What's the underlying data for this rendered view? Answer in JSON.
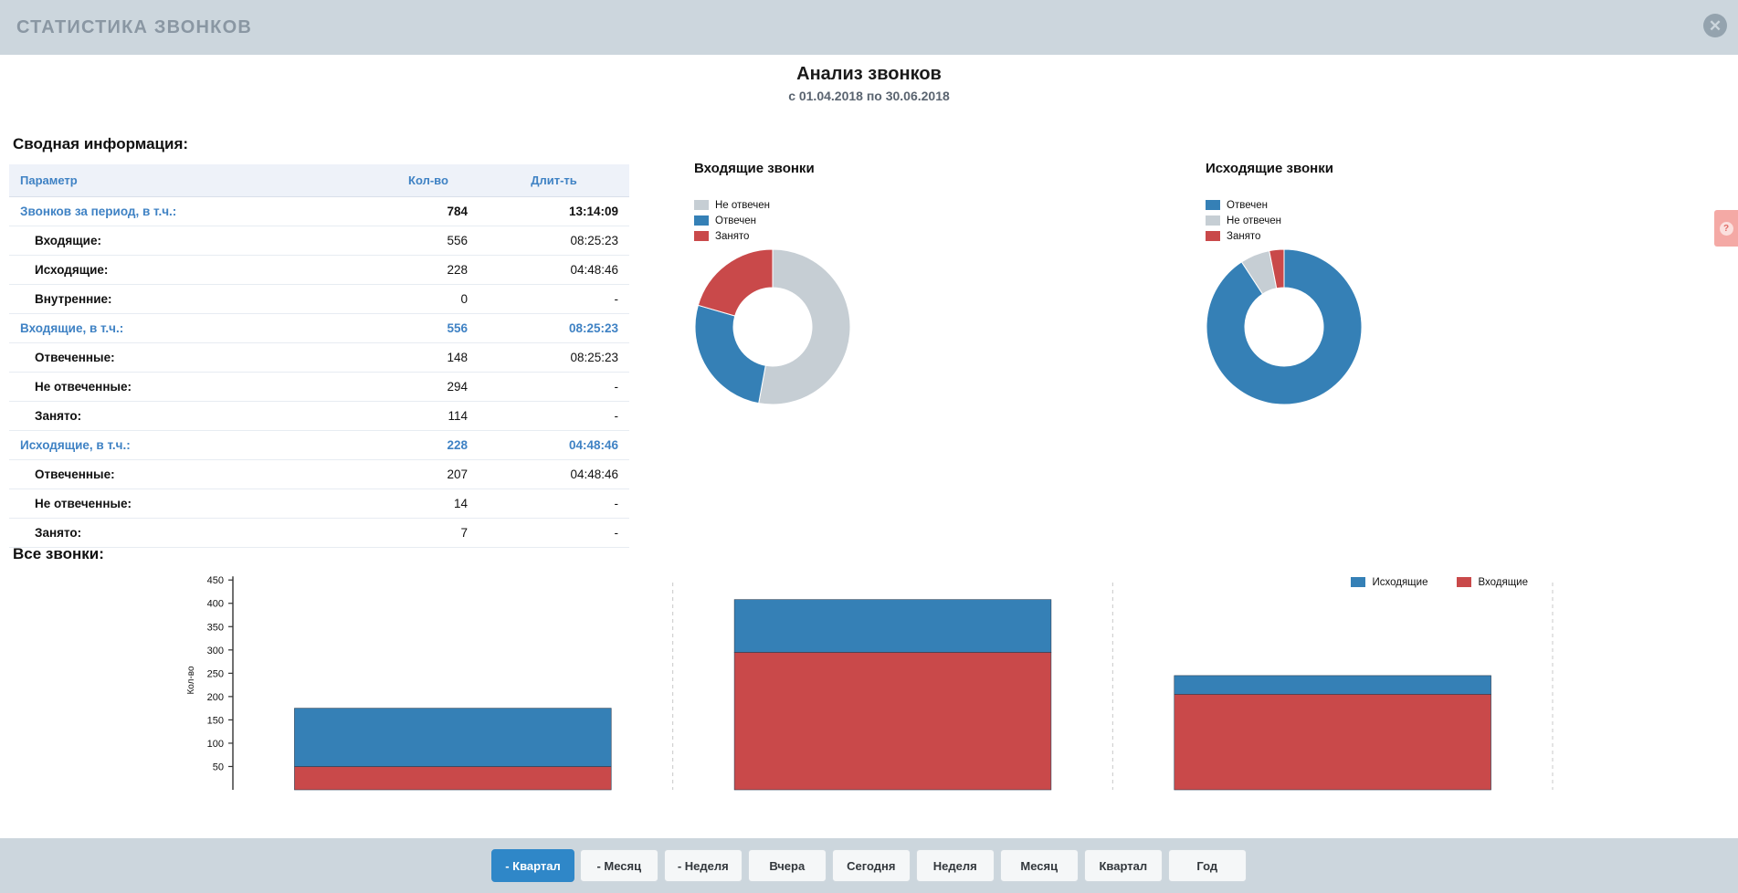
{
  "window": {
    "title": "СТАТИСТИКА ЗВОНКОВ",
    "close_icon": "close-circle-icon"
  },
  "report": {
    "title": "Анализ звонков",
    "subtitle": "с 01.04.2018 по 30.06.2018"
  },
  "sections": {
    "summary_label": "Сводная информация:",
    "all_calls_label": "Все звонки:"
  },
  "summary_table": {
    "columns": [
      "Параметр",
      "Кол-во",
      "Длит-ть"
    ],
    "rows": [
      {
        "level": 0,
        "total": true,
        "param": "Звонков за период, в т.ч.:",
        "count": "784",
        "duration": "13:14:09"
      },
      {
        "level": 1,
        "total": false,
        "param": "Входящие:",
        "count": "556",
        "duration": "08:25:23"
      },
      {
        "level": 1,
        "total": false,
        "param": "Исходящие:",
        "count": "228",
        "duration": "04:48:46"
      },
      {
        "level": 1,
        "total": false,
        "param": "Внутренние:",
        "count": "0",
        "duration": "-"
      },
      {
        "level": 0,
        "total": false,
        "param": "Входящие, в т.ч.:",
        "count": "556",
        "duration": "08:25:23"
      },
      {
        "level": 1,
        "total": false,
        "param": "Отвеченные:",
        "count": "148",
        "duration": "08:25:23"
      },
      {
        "level": 1,
        "total": false,
        "param": "Не отвеченные:",
        "count": "294",
        "duration": "-"
      },
      {
        "level": 1,
        "total": false,
        "param": "Занято:",
        "count": "114",
        "duration": "-"
      },
      {
        "level": 0,
        "total": false,
        "param": "Исходящие, в т.ч.:",
        "count": "228",
        "duration": "04:48:46"
      },
      {
        "level": 1,
        "total": false,
        "param": "Отвеченные:",
        "count": "207",
        "duration": "04:48:46"
      },
      {
        "level": 1,
        "total": false,
        "param": "Не отвеченные:",
        "count": "14",
        "duration": "-"
      },
      {
        "level": 1,
        "total": false,
        "param": "Занято:",
        "count": "7",
        "duration": "-"
      }
    ]
  },
  "colors": {
    "blue": "#3580b6",
    "red": "#c9494a",
    "grey": "#c6ced4",
    "accent": "#2f87c8",
    "chrome": "#ccd6dd",
    "link": "#3f82c4"
  },
  "buttons": [
    {
      "label": "- Квартал",
      "active": true
    },
    {
      "label": "- Месяц",
      "active": false
    },
    {
      "label": "- Неделя",
      "active": false
    },
    {
      "label": "Вчера",
      "active": false
    },
    {
      "label": "Сегодня",
      "active": false
    },
    {
      "label": "Неделя",
      "active": false
    },
    {
      "label": "Месяц",
      "active": false
    },
    {
      "label": "Квартал",
      "active": false
    },
    {
      "label": "Год",
      "active": false
    }
  ],
  "help": {
    "icon": "question-mark-icon",
    "label": "?"
  },
  "chart_data": [
    {
      "type": "pie",
      "name": "incoming-donut",
      "title": "Входящие звонки",
      "labels": [
        "Не отвечен",
        "Отвечен",
        "Занято"
      ],
      "values": [
        294,
        148,
        114
      ],
      "colors": [
        "#c6ced4",
        "#3580b6",
        "#c9494a"
      ],
      "legend_position": "top-left",
      "donut": true
    },
    {
      "type": "pie",
      "name": "outgoing-donut",
      "title": "Исходящие звонки",
      "labels": [
        "Отвечен",
        "Не отвечен",
        "Занято"
      ],
      "values": [
        207,
        14,
        7
      ],
      "colors": [
        "#3580b6",
        "#c6ced4",
        "#c9494a"
      ],
      "legend_position": "top-left",
      "donut": true
    },
    {
      "type": "bar",
      "name": "all-calls-bar",
      "title": "Все звонки:",
      "stacked": true,
      "categories": [
        "",
        "",
        ""
      ],
      "series": [
        {
          "name": "Входящие",
          "color": "#c9494a",
          "values": [
            50,
            295,
            205
          ]
        },
        {
          "name": "Исходящие",
          "color": "#3580b6",
          "values": [
            125,
            113,
            40
          ]
        }
      ],
      "ylabel": "Кол-во",
      "xlabel": "",
      "ylim": [
        0,
        470
      ],
      "yticks": [
        50,
        100,
        150,
        200,
        250,
        300,
        350,
        400,
        450
      ],
      "grid": true,
      "legend_position": "top-right",
      "legend": [
        "Исходящие",
        "Входящие"
      ]
    }
  ]
}
